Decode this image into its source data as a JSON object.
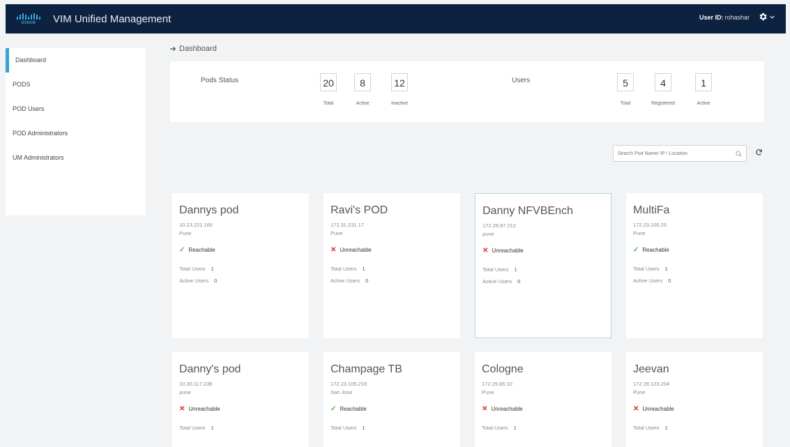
{
  "header": {
    "brand": "cisco",
    "title": "VIM Unified Management",
    "user_id_label": "User ID:",
    "user_id_value": "rohashar",
    "settings_icon": "gear-icon"
  },
  "sidebar": {
    "items": [
      {
        "label": "Dashboard",
        "active": true
      },
      {
        "label": "PODS"
      },
      {
        "label": "POD Users"
      },
      {
        "label": "POD Administrators"
      },
      {
        "label": "UM Administrators"
      }
    ]
  },
  "breadcrumb": {
    "label": "Dashboard"
  },
  "pods_status": {
    "title": "Pods Status",
    "total": "20",
    "total_label": "Total",
    "active": "8",
    "active_label": "Active",
    "inactive": "12",
    "inactive_label": "Inactive"
  },
  "users": {
    "title": "Users",
    "total": "5",
    "total_label": "Total",
    "registered": "4",
    "registered_label": "Registered",
    "active": "1",
    "active_label": "Active"
  },
  "search": {
    "placeholder": "Search Pod Name/ IP / Location"
  },
  "pods": [
    {
      "name": "Dannys pod",
      "ip": "10.23.221.160",
      "location": "Pune",
      "status": "Reachable",
      "reachable": true,
      "total_users_label": "Total Users",
      "total_users": "1",
      "active_users_label": "Active Users",
      "active_users": "0"
    },
    {
      "name": "Ravi's POD",
      "ip": "172.31.231.17",
      "location": "Pune",
      "status": "Unreachable",
      "reachable": false,
      "total_users_label": "Total Users",
      "total_users": "1",
      "active_users_label": "Active Users",
      "active_users": "0"
    },
    {
      "name": "Danny NFVBEnch",
      "ip": "172.29.87.212",
      "location": "pune",
      "status": "Unreachable",
      "reachable": false,
      "total_users_label": "Total Users",
      "total_users": "1",
      "active_users_label": "Active Users",
      "active_users": "0"
    },
    {
      "name": "MultiFa",
      "ip": "172.23.105.25",
      "location": "Pune",
      "status": "Reachable",
      "reachable": true,
      "total_users_label": "Total Users",
      "total_users": "1",
      "active_users_label": "Active Users",
      "active_users": "0"
    },
    {
      "name": "Danny's pod",
      "ip": "10.30.117.238",
      "location": "pune",
      "status": "Unreachable",
      "reachable": false,
      "total_users_label": "Total Users",
      "total_users": "1"
    },
    {
      "name": "Champage TB",
      "ip": "172.23.105.218",
      "location": "San Jose",
      "status": "Reachable",
      "reachable": true,
      "total_users_label": "Total Users",
      "total_users": "1"
    },
    {
      "name": "Cologne",
      "ip": "172.29.86.10",
      "location": "Pune",
      "status": "Unreachable",
      "reachable": false,
      "total_users_label": "Total Users",
      "total_users": "1"
    },
    {
      "name": "Jeevan",
      "ip": "172.28.123.204",
      "location": "Pune",
      "status": "Unreachable",
      "reachable": false,
      "total_users_label": "Total Users",
      "total_users": "1"
    }
  ],
  "colors": {
    "topbar": "#0d2240",
    "accent": "#3aa0d8",
    "ok": "#4caf50",
    "error": "#d32f2f"
  }
}
